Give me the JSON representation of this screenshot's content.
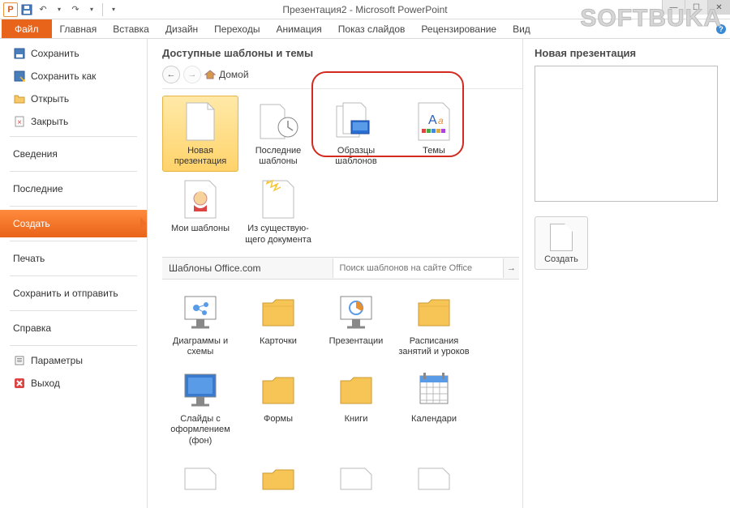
{
  "window": {
    "title": "Презентация2 - Microsoft PowerPoint"
  },
  "ribbon": {
    "file": "Файл",
    "tabs": [
      "Главная",
      "Вставка",
      "Дизайн",
      "Переходы",
      "Анимация",
      "Показ слайдов",
      "Рецензирование",
      "Вид"
    ]
  },
  "sidebar": {
    "save": "Сохранить",
    "save_as": "Сохранить как",
    "open": "Открыть",
    "close": "Закрыть",
    "info": "Сведения",
    "recent": "Последние",
    "new": "Создать",
    "print": "Печать",
    "save_send": "Сохранить и отправить",
    "help": "Справка",
    "options": "Параметры",
    "exit": "Выход"
  },
  "center": {
    "heading": "Доступные шаблоны и темы",
    "breadcrumb_home": "Домой",
    "tiles_row1": [
      {
        "label": "Новая презентация",
        "icon": "blank",
        "selected": true
      },
      {
        "label": "Последние шаблоны",
        "icon": "recent"
      },
      {
        "label": "Образцы шаблонов",
        "icon": "samples"
      },
      {
        "label": "Темы",
        "icon": "themes"
      }
    ],
    "tiles_row2": [
      {
        "label": "Мои шаблоны",
        "icon": "my"
      },
      {
        "label": "Из существую- щего документа",
        "icon": "existing"
      }
    ],
    "office_section": "Шаблоны Office.com",
    "search_placeholder": "Поиск шаблонов на сайте Office",
    "office_tiles_r1": [
      {
        "label": "Диаграммы и схемы",
        "icon": "diagram"
      },
      {
        "label": "Карточки",
        "icon": "folder"
      },
      {
        "label": "Презентации",
        "icon": "presentation"
      },
      {
        "label": "Расписания занятий и уроков",
        "icon": "folder"
      }
    ],
    "office_tiles_r2": [
      {
        "label": "Слайды с оформлением (фон)",
        "icon": "slide-bg"
      },
      {
        "label": "Формы",
        "icon": "folder"
      },
      {
        "label": "Книги",
        "icon": "folder"
      },
      {
        "label": "Календари",
        "icon": "calendar"
      }
    ]
  },
  "right": {
    "heading": "Новая презентация",
    "create": "Создать"
  },
  "watermark": "SOFTBUKA"
}
